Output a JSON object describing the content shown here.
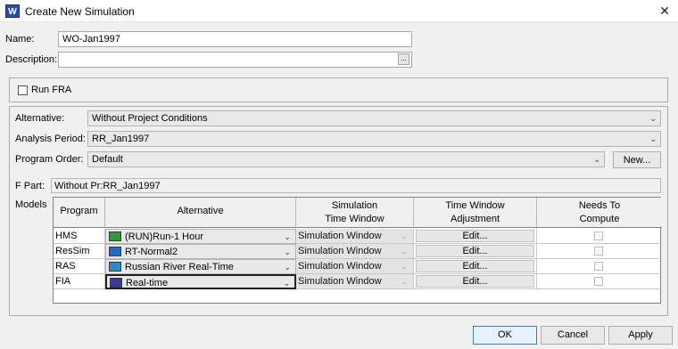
{
  "window": {
    "title": "Create New Simulation",
    "app_icon": "W"
  },
  "name": {
    "label": "Name:",
    "value": "WO-Jan1997"
  },
  "description": {
    "label": "Description:",
    "value": "",
    "browse_label": "..."
  },
  "run_fra": {
    "label": "Run FRA",
    "checked": false
  },
  "alternative": {
    "label": "Alternative:",
    "value": "Without Project Conditions"
  },
  "analysis_period": {
    "label": "Analysis Period:",
    "value": "RR_Jan1997"
  },
  "program_order": {
    "label": "Program Order:",
    "value": "Default",
    "new_button": "New..."
  },
  "f_part": {
    "label": "F Part:",
    "value": "Without Pr:RR_Jan1997"
  },
  "models": {
    "label": "Models",
    "columns": {
      "program": "Program",
      "alternative": "Alternative",
      "sim_line1": "Simulation",
      "sim_line2": "Time Window",
      "adj_line1": "Time Window",
      "adj_line2": "Adjustment",
      "needs_line1": "Needs To",
      "needs_line2": "Compute"
    },
    "rows": [
      {
        "program": "HMS",
        "alternative": "(RUN)Run-1 Hour",
        "icon": "hms-icon",
        "icon_color": "#2e9a3a",
        "sim_window": "Simulation Window",
        "adjust": "Edit...",
        "needs_compute": false
      },
      {
        "program": "ResSim",
        "alternative": "RT-Normal2",
        "icon": "ressim-icon",
        "icon_color": "#1d6cc4",
        "sim_window": "Simulation Window",
        "adjust": "Edit...",
        "needs_compute": false
      },
      {
        "program": "RAS",
        "alternative": "Russian River Real-Time",
        "icon": "ras-icon",
        "icon_color": "#2b8cc9",
        "sim_window": "Simulation Window",
        "adjust": "Edit...",
        "needs_compute": false
      },
      {
        "program": "FIA",
        "alternative": "Real-time",
        "icon": "fia-icon",
        "icon_color": "#3a3a9a",
        "sim_window": "Simulation Window",
        "adjust": "Edit...",
        "needs_compute": false
      }
    ]
  },
  "buttons": {
    "ok": "OK",
    "cancel": "Cancel",
    "apply": "Apply"
  },
  "colors": {
    "accent": "#3c7fb1",
    "background": "#f0f0f0"
  }
}
